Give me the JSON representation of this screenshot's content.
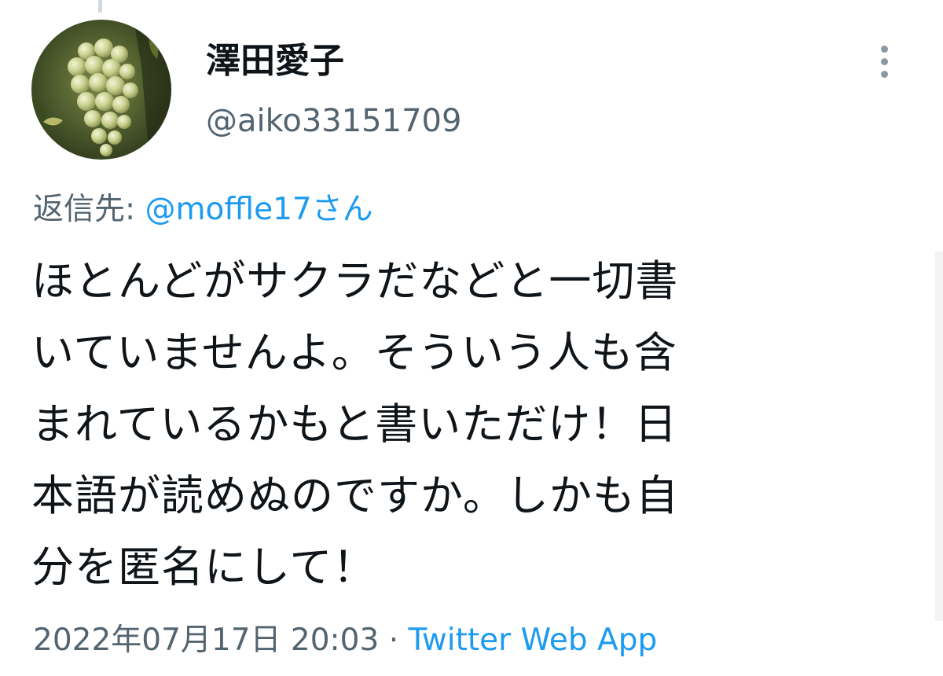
{
  "tweet": {
    "author": {
      "display_name": "澤田愛子",
      "handle": "@aiko33151709"
    },
    "reply_to": {
      "prefix": "返信先: ",
      "mention": "@moffle17さん"
    },
    "text": "ほとんどがサクラだなどと一切書\nいていませんよ。そういう人も含\nまれているかもと書いただけ！日\n本語が読めぬのですか。しかも自\n分を匿名にして！",
    "timestamp": "2022年07月17日 20:03",
    "separator": " · ",
    "source": "Twitter Web App"
  },
  "icons": {
    "more": "more-vertical-icon",
    "avatar": "grapes-photo"
  },
  "colors": {
    "text_primary": "#0f1419",
    "text_secondary": "#536471",
    "link": "#1d9bf0"
  }
}
